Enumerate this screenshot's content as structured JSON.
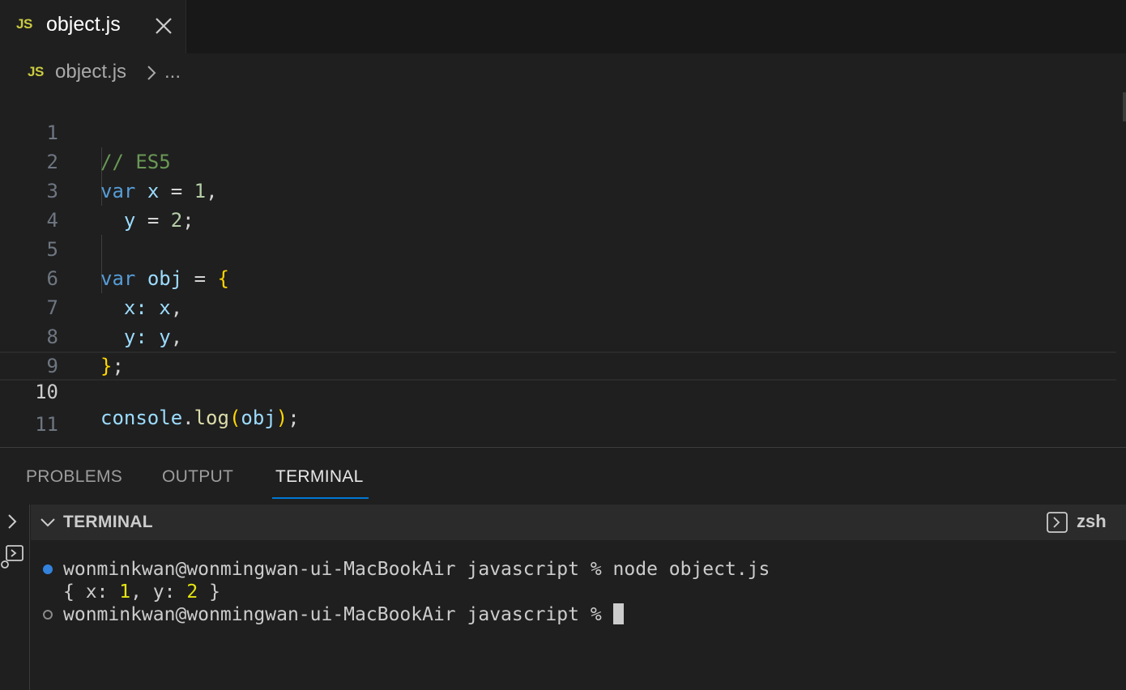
{
  "tab": {
    "badge": "JS",
    "title": "object.js"
  },
  "breadcrumb": {
    "badge": "JS",
    "file": "object.js",
    "more": "..."
  },
  "editor": {
    "current_line": 10,
    "lines": [
      {
        "n": "1"
      },
      {
        "n": "2"
      },
      {
        "n": "3"
      },
      {
        "n": "4"
      },
      {
        "n": "5"
      },
      {
        "n": "6"
      },
      {
        "n": "7"
      },
      {
        "n": "8"
      },
      {
        "n": "9"
      },
      {
        "n": "10"
      },
      {
        "n": "11"
      }
    ],
    "code": {
      "l1": {
        "comment": "// ES5"
      },
      "l2": {
        "kw": "var",
        "name": "x",
        "op": "=",
        "num": "1",
        "punct": ","
      },
      "l3": {
        "name": "y",
        "op": "=",
        "num": "2",
        "punct": ";"
      },
      "l5": {
        "kw": "var",
        "name": "obj",
        "op": "=",
        "brace": "{"
      },
      "l6": {
        "key": "x",
        "colon": ":",
        "val": "x",
        "punct": ","
      },
      "l7": {
        "key": "y",
        "colon": ":",
        "val": "y",
        "punct": ","
      },
      "l8": {
        "brace": "}",
        "punct": ";"
      },
      "l10": {
        "obj": "console",
        "dot": ".",
        "fn": "log",
        "open": "(",
        "arg": "obj",
        "close": ")",
        "punct": ";"
      }
    }
  },
  "panel": {
    "tabs": [
      "PROBLEMS",
      "OUTPUT",
      "TERMINAL"
    ],
    "active_tab": "TERMINAL",
    "terminal_title": "TERMINAL",
    "shell": "zsh"
  },
  "terminal": {
    "line1": {
      "prompt": "wonminkwan@wonmingwan-ui-MacBookAir javascript %",
      "command": "node object.js"
    },
    "line2": {
      "open": "{ x: ",
      "x": "1",
      "mid": ", y: ",
      "y": "2",
      "close": " }"
    },
    "line3": {
      "prompt": "wonminkwan@wonmingwan-ui-MacBookAir javascript %"
    }
  },
  "colors": {
    "accent": "#0078d4",
    "js_badge": "#cbcb41",
    "keyword": "#569cd6",
    "variable": "#9cdcfe",
    "number": "#b5cea8",
    "comment": "#6a9955",
    "brace": "#ffd700",
    "function": "#dcdcaa",
    "paren": "#da70d6"
  },
  "icons": {
    "tab_close": "close-icon",
    "breadcrumb_sep": "chevron-right-icon",
    "panel_collapse": "chevron-down-icon",
    "shell": "terminal-icon"
  }
}
